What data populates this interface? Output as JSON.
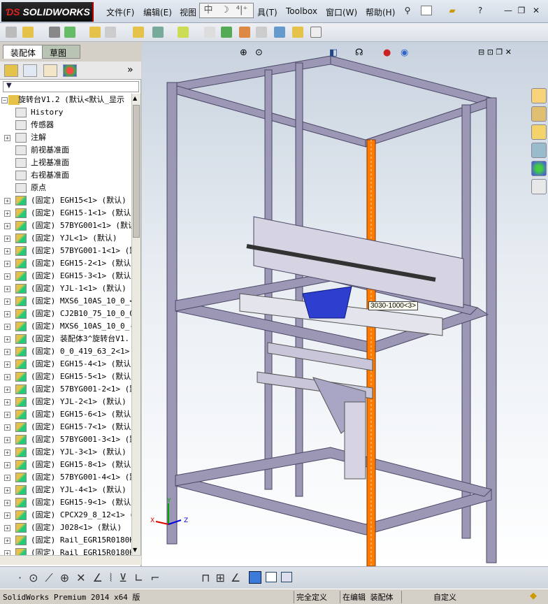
{
  "app": {
    "logo_ds": "ƊS",
    "logo_text": "SOLIDWORKS"
  },
  "menu": {
    "file": "文件(F)",
    "edit": "编辑(E)",
    "view": "视图",
    "tools": "具(T)",
    "toolbox": "Toolbox",
    "window": "窗口(W)",
    "help": "帮助(H)"
  },
  "ime": {
    "mode": "中",
    "moon": "☽",
    "punct": "⁴|⁺"
  },
  "panel": {
    "tab_assembly": "装配体",
    "tab_sketch": "草图",
    "root_label": "旋转台V1.2  (默认<默认_显示",
    "items": [
      {
        "label": "History",
        "expand": ""
      },
      {
        "label": "传感器",
        "expand": ""
      },
      {
        "label": "注解",
        "expand": "+"
      },
      {
        "label": "前视基准面",
        "expand": ""
      },
      {
        "label": "上视基准面",
        "expand": ""
      },
      {
        "label": "右视基准面",
        "expand": ""
      },
      {
        "label": "原点",
        "expand": ""
      },
      {
        "label": "(固定) EGH15<1> (默认)",
        "expand": "+"
      },
      {
        "label": "(固定) EGH15-1<1> (默认)",
        "expand": "+"
      },
      {
        "label": "(固定) 57BYG001<1> (默认",
        "expand": "+"
      },
      {
        "label": "(固定) YJL<1> (默认)",
        "expand": "+"
      },
      {
        "label": "(固定) 57BYG001-1<1> (默",
        "expand": "+"
      },
      {
        "label": "(固定) EGH15-2<1> (默认)",
        "expand": "+"
      },
      {
        "label": "(固定) EGH15-3<1> (默认)",
        "expand": "+"
      },
      {
        "label": "(固定) YJL-1<1> (默认)",
        "expand": "+"
      },
      {
        "label": "(固定) MXS6_10AS_10_0_<1",
        "expand": "+"
      },
      {
        "label": "(固定) CJ2B10_75_10_0_0_",
        "expand": "+"
      },
      {
        "label": "(固定) MXS6_10AS_10_0_-1",
        "expand": "+"
      },
      {
        "label": "(固定) 装配体3^旋转台V1.",
        "expand": "+"
      },
      {
        "label": "(固定) 0_0_419_63_2<1> (",
        "expand": "+"
      },
      {
        "label": "(固定) EGH15-4<1> (默认)",
        "expand": "+"
      },
      {
        "label": "(固定) EGH15-5<1> (默认)",
        "expand": "+"
      },
      {
        "label": "(固定) 57BYG001-2<1> (默",
        "expand": "+"
      },
      {
        "label": "(固定) YJL-2<1> (默认)",
        "expand": "+"
      },
      {
        "label": "(固定) EGH15-6<1> (默认)",
        "expand": "+"
      },
      {
        "label": "(固定) EGH15-7<1> (默认)",
        "expand": "+"
      },
      {
        "label": "(固定) 57BYG001-3<1> (默",
        "expand": "+"
      },
      {
        "label": "(固定) YJL-3<1> (默认)",
        "expand": "+"
      },
      {
        "label": "(固定) EGH15-8<1> (默认)",
        "expand": "+"
      },
      {
        "label": "(固定) 57BYG001-4<1> (默",
        "expand": "+"
      },
      {
        "label": "(固定) YJL-4<1> (默认)",
        "expand": "+"
      },
      {
        "label": "(固定) EGH15-9<1> (默认)",
        "expand": "+"
      },
      {
        "label": "(固定) CPCX29_8_12<1> (",
        "expand": "+"
      },
      {
        "label": "(固定) J028<1> (默认)",
        "expand": "+"
      },
      {
        "label": "(固定) Rail_EGR15R0180H1",
        "expand": "+"
      },
      {
        "label": "(固定) Rail_EGR15R0180H1",
        "expand": "+"
      }
    ]
  },
  "viewport": {
    "callout": "3030-1000<3>",
    "axis_x": "X",
    "axis_y": "Y",
    "axis_z": "Z"
  },
  "status": {
    "product": "SolidWorks Premium 2014 x64 版",
    "defined": "完全定义",
    "editing": "在编辑 装配体",
    "custom": "自定义"
  },
  "colors": {
    "frame": "#9b97b5",
    "highlight": "#ff7a00",
    "part_blue": "#2e3fcf"
  }
}
